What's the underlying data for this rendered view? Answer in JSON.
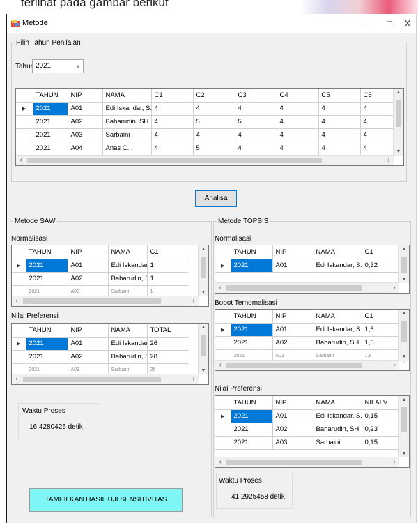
{
  "caption": {
    "text": "terlihat pada gambar berikut"
  },
  "window": {
    "title": "Metode",
    "minimize": "–",
    "maximize": "□",
    "close": "X"
  },
  "tahun_group": {
    "legend": "Pilih Tahun Penilaian",
    "label": "Tahun",
    "selected": "2021"
  },
  "main_grid": {
    "columns": [
      "TAHUN",
      "NIP",
      "NAMA",
      "C1",
      "C2",
      "C3",
      "C4",
      "C5",
      "C6"
    ],
    "rows": [
      [
        "2021",
        "A01",
        "Edi Iskandar, S.S...",
        "4",
        "4",
        "4",
        "4",
        "4",
        "4"
      ],
      [
        "2021",
        "A02",
        "Baharudin, SH",
        "4",
        "5",
        "5",
        "4",
        "4",
        "4"
      ],
      [
        "2021",
        "A03",
        "Sarbaini",
        "4",
        "4",
        "4",
        "4",
        "4",
        "4"
      ],
      [
        "2021",
        "A04",
        "Anas C...",
        "4",
        "5",
        "4",
        "4",
        "4",
        "4"
      ]
    ]
  },
  "analisa_button": "Analisa",
  "saw": {
    "legend": "Metode SAW",
    "norm_label": "Normalisasi",
    "norm_columns": [
      "TAHUN",
      "NIP",
      "NAMA",
      "C1"
    ],
    "norm_rows": [
      [
        "2021",
        "A01",
        "Edi Iskandar, S.S...",
        "1"
      ],
      [
        "2021",
        "A02",
        "Baharudin, SH",
        "1"
      ],
      [
        "2021",
        "A03",
        "Sarbaini",
        "1"
      ]
    ],
    "pref_label": "Nilai Preferensi",
    "pref_columns": [
      "TAHUN",
      "NIP",
      "NAMA",
      "TOTAL"
    ],
    "pref_rows": [
      [
        "2021",
        "A01",
        "Edi Iskandar, S.S...",
        "26"
      ],
      [
        "2021",
        "A02",
        "Baharudin, SH",
        "28"
      ],
      [
        "2021",
        "A03",
        "Sarbaini",
        "26"
      ]
    ],
    "time_label": "Waktu Proses",
    "time_value": "16,4280426 detik"
  },
  "topsis": {
    "legend": "Metode TOPSIS",
    "norm_label": "Normalisasi",
    "norm_columns": [
      "TAHUN",
      "NIP",
      "NAMA",
      "C1"
    ],
    "norm_rows": [
      [
        "2021",
        "A01",
        "Edi Iskandar, S.S...",
        "0,32"
      ]
    ],
    "bobot_label": "Bobot Ternomalisasi",
    "bobot_columns": [
      "TAHUN",
      "NIP",
      "NAMA",
      "C1"
    ],
    "bobot_rows": [
      [
        "2021",
        "A01",
        "Edi Iskandar, S.S...",
        "1,6"
      ],
      [
        "2021",
        "A02",
        "Baharudin, SH",
        "1,6"
      ],
      [
        "2021",
        "A03",
        "Sarbaini",
        "1,6"
      ]
    ],
    "pref_label": "Nilai Preferensi",
    "pref_columns": [
      "TAHUN",
      "NIP",
      "NAMA",
      "NILAI V"
    ],
    "pref_rows": [
      [
        "2021",
        "A01",
        "Edi Iskandar, S.S...",
        "0,15"
      ],
      [
        "2021",
        "A02",
        "Baharudin, SH",
        "0,23"
      ],
      [
        "2021",
        "A03",
        "Sarbaini",
        "0,15"
      ]
    ],
    "time_label": "Waktu Proses",
    "time_value": "41,2925458 detik"
  },
  "sensitivity_button": "TAMPILKAN HASIL UJI SENSITIVITAS"
}
